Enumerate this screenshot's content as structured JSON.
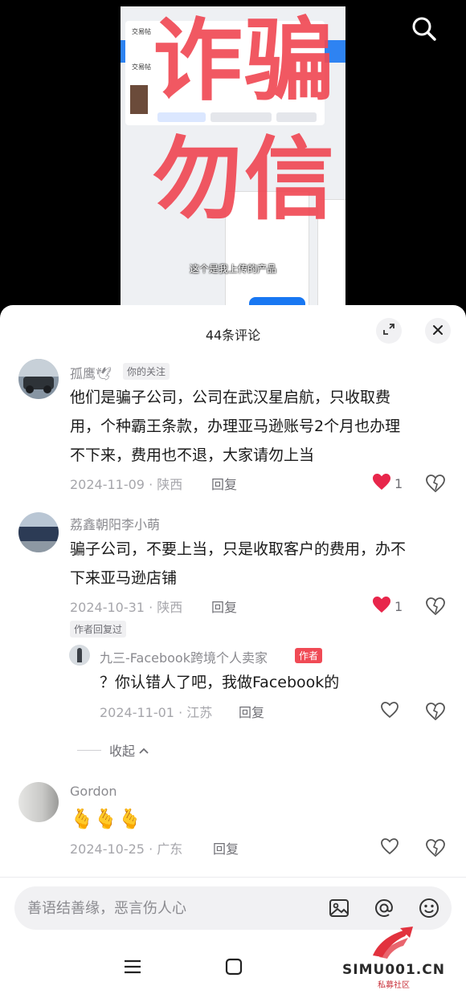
{
  "video": {
    "overlay_line1": "诈骗",
    "overlay_line2": "勿信",
    "subtitle": "这个是我上传的产品",
    "fb_title": "交易帖",
    "fb_sub": "交易帖"
  },
  "sheet": {
    "title": "44条评论"
  },
  "comments": [
    {
      "username": "孤鹰🕊",
      "tag": "你的关注",
      "lines": [
        "他们是骗子公司，公司在武汉星启航，只收取费",
        "用，个种霸王条款，办理亚马逊账号2个月也办理",
        "不下来，费用也不退，大家请勿上当"
      ],
      "date": "2024-11-09 · 陕西",
      "reply": "回复",
      "likes": "1"
    },
    {
      "username": "荔鑫朝阳李小萌",
      "lines": [
        "骗子公司，不要上当，只是收取客户的费用，办不",
        "下来亚马逊店铺"
      ],
      "date": "2024-10-31 · 陕西",
      "reply": "回复",
      "likes": "1",
      "author_replied": "作者回复过"
    },
    {
      "username": "九三-Facebook跨境个人卖家",
      "author_tag": "作者",
      "text": "？你认错人了吧，我做Facebook的",
      "date": "2024-11-01 · 江苏",
      "reply": "回复"
    },
    {
      "username": "Gordon",
      "text": "🫰🫰🫰",
      "date": "2024-10-25 · 广东",
      "reply": "回复"
    }
  ],
  "collapse_label": "收起",
  "input": {
    "placeholder": "善语结善缘，恶言伤人心"
  },
  "watermark": {
    "text": "SIMU001.CN",
    "sub": "私募社区"
  },
  "colors": {
    "accent_red": "#f04a55",
    "like_red": "#e8264b"
  },
  "icons": [
    "search-icon",
    "expand-icon",
    "close-icon",
    "heart-icon",
    "dislike-heart-icon",
    "image-icon",
    "at-icon",
    "emoji-icon",
    "menu-icon",
    "home-square-icon",
    "chevron-up-icon"
  ]
}
